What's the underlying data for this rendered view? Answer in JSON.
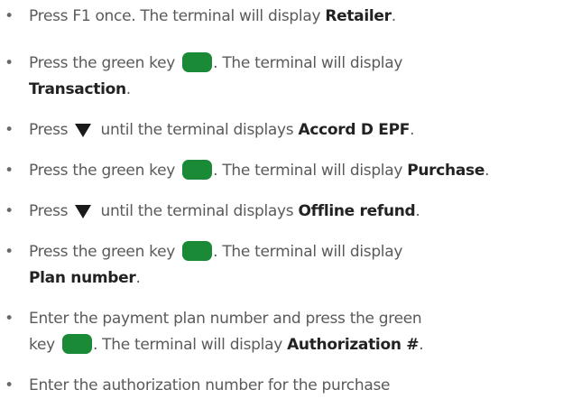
{
  "steps": [
    {
      "l1_pre": "Press F1 once. The terminal will display ",
      "l1_bold": "Retailer",
      "l1_post": "."
    },
    {
      "l1_pre": "Press the green key ",
      "l1_post": ". The terminal will display",
      "l2_bold": "Transaction",
      "l2_post": "."
    },
    {
      "l1_pre": "Press ",
      "l1_mid": " until the terminal displays ",
      "l1_bold": "Accord D EPF",
      "l1_post": "."
    },
    {
      "l1_pre": "Press the green key ",
      "l1_mid": ". The terminal will display ",
      "l1_bold": "Purchase",
      "l1_post": "."
    },
    {
      "l1_pre": "Press ",
      "l1_mid": " until the terminal displays ",
      "l1_bold": "Offline refund",
      "l1_post": "."
    },
    {
      "l1_pre": "Press the green key ",
      "l1_post": ". The terminal will display",
      "l2_bold": "Plan number",
      "l2_post": "."
    },
    {
      "l1_pre": "Enter the payment plan number and press the green",
      "l2_pre": "key ",
      "l2_mid": ". The terminal will display ",
      "l2_bold": "Authorization #",
      "l2_post": "."
    },
    {
      "l1_pre": "Enter the authorization number for the purchase"
    }
  ],
  "bullet_char": "•",
  "icons": {
    "green_key": {
      "name": "green-key-icon",
      "color": "#1a8a36"
    },
    "down_arrow": {
      "name": "down-triangle-icon",
      "color": "#1a1a1a"
    }
  }
}
